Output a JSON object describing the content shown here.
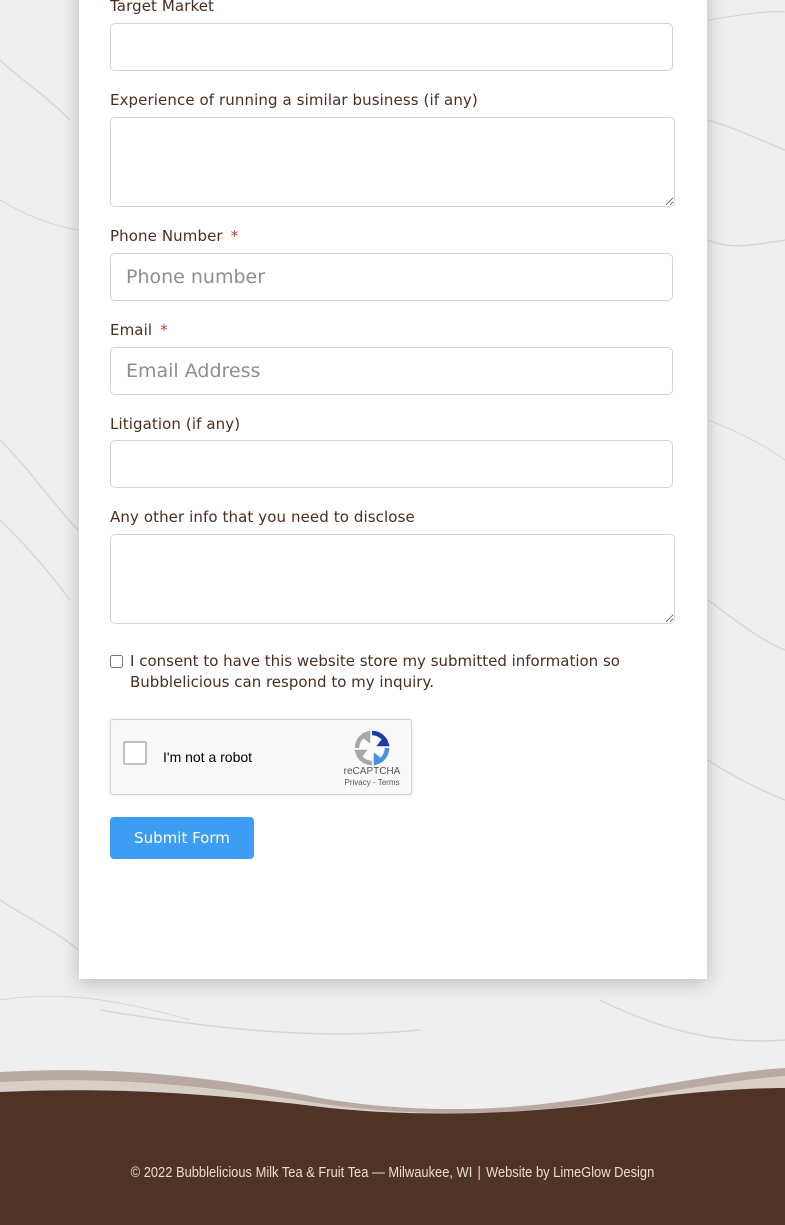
{
  "form": {
    "target_market": {
      "label": "Target Market",
      "value": ""
    },
    "experience": {
      "label": "Experience of running a similar business (if any)",
      "value": ""
    },
    "phone": {
      "label": "Phone Number",
      "required_mark": "*",
      "placeholder": "Phone number"
    },
    "email": {
      "label": "Email",
      "required_mark": "*",
      "placeholder": "Email Address"
    },
    "litigation": {
      "label": "Litigation (if any)",
      "value": ""
    },
    "other_info": {
      "label": "Any other info that you need to disclose",
      "value": ""
    },
    "consent": {
      "text": "I consent to have this website store my submitted information so Bubblelicious can respond to my inquiry.",
      "checked": false
    },
    "captcha": {
      "label": "I'm not a robot",
      "brand": "reCAPTCHA",
      "privacy": "Privacy",
      "separator": " - ",
      "terms": "Terms"
    },
    "submit_label": "Submit Form"
  },
  "footer": {
    "copyright": "© 2022 Bubblelicious Milk Tea & Fruit Tea — Milwaukee, WI",
    "divider": "|",
    "credit": "Website by LimeGlow Design"
  },
  "colors": {
    "label_text": "#4b2e1e",
    "required": "#c0392b",
    "submit_button": "#3d9df3",
    "footer_background": "#4f3426",
    "footer_text": "#e8dcd4",
    "page_background": "#efefef"
  },
  "icons": {
    "captcha_logo": "recaptcha-logo-icon"
  }
}
